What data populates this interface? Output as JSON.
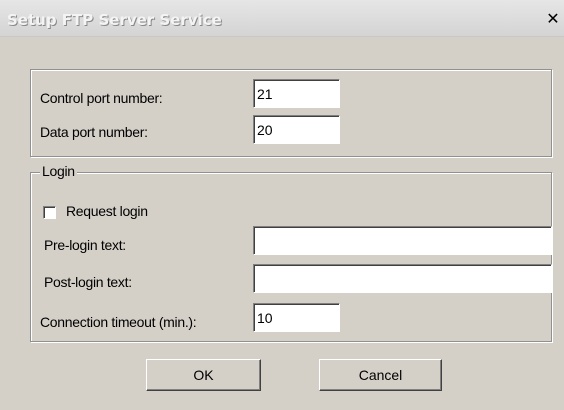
{
  "window": {
    "title": "Setup FTP Server Service",
    "close_glyph": "✕"
  },
  "ports": {
    "control_label": "Control port number:",
    "control_value": "21",
    "data_label": "Data port number:",
    "data_value": "20"
  },
  "login": {
    "group_label": "Login",
    "request_login_label": "Request login",
    "request_login_checked": false,
    "pre_login_label": "Pre-login text:",
    "pre_login_value": "",
    "post_login_label": "Post-login text:",
    "post_login_value": "",
    "timeout_label": "Connection timeout (min.):",
    "timeout_value": "10"
  },
  "buttons": {
    "ok_label": "OK",
    "cancel_label": "Cancel"
  }
}
